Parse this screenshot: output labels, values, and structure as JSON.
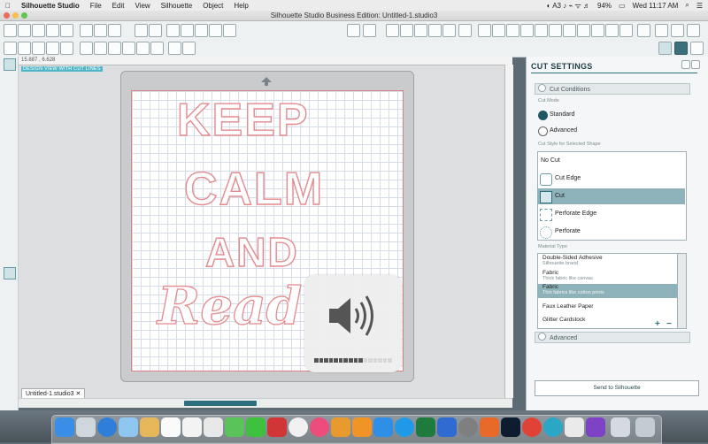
{
  "menubar": {
    "app": "Silhouette Studio",
    "items": [
      "File",
      "Edit",
      "View",
      "Silhouette",
      "Object",
      "Help"
    ],
    "battery": "94%",
    "clock": "Wed 11:17 AM"
  },
  "window": {
    "title": "Silhouette Studio Business Edition: Untitled-1.studio3"
  },
  "canvas": {
    "coords": "15.887 , 6.628",
    "view_label": "DESIGN VIEW WITH CUT LINES",
    "design_lines": [
      "KEEP",
      "CALM",
      "AND",
      "Read"
    ],
    "doc_tab": "Untitled-1.studio3"
  },
  "volume": {
    "level": 0.64
  },
  "panel": {
    "title": "CUT SETTINGS",
    "section_cut_conditions": "Cut Conditions",
    "cut_mode_label": "Cut Mode",
    "modes": [
      {
        "label": "Standard",
        "selected": true
      },
      {
        "label": "Advanced",
        "selected": false
      }
    ],
    "cut_style_label": "Cut Style for Selected Shape",
    "cut_styles": [
      {
        "label": "No Cut",
        "selected": false
      },
      {
        "label": "Cut Edge",
        "selected": false
      },
      {
        "label": "Cut",
        "selected": true
      },
      {
        "label": "Perforate Edge",
        "selected": false
      },
      {
        "label": "Perforate",
        "selected": false
      }
    ],
    "material_type_label": "Material Type",
    "materials": [
      {
        "name": "Double-Sided Adhesive",
        "desc": "Silhouette brand",
        "selected": false
      },
      {
        "name": "Fabric",
        "desc": "Thick fabric like canvas",
        "selected": false
      },
      {
        "name": "Fabric",
        "desc": "Thin fabrics like cotton prints",
        "selected": true
      },
      {
        "name": "Faux Leather Paper",
        "desc": "",
        "selected": false
      },
      {
        "name": "Glitter Cardstock",
        "desc": "",
        "selected": false
      }
    ],
    "add_symbol": "+",
    "remove_symbol": "−",
    "section_advanced": "Advanced",
    "send_button": "Send to Silhouette"
  },
  "colors": {
    "accent": "#2d6f7c",
    "cut_line": "#e38b8f",
    "selection": "#8eb2b9"
  }
}
